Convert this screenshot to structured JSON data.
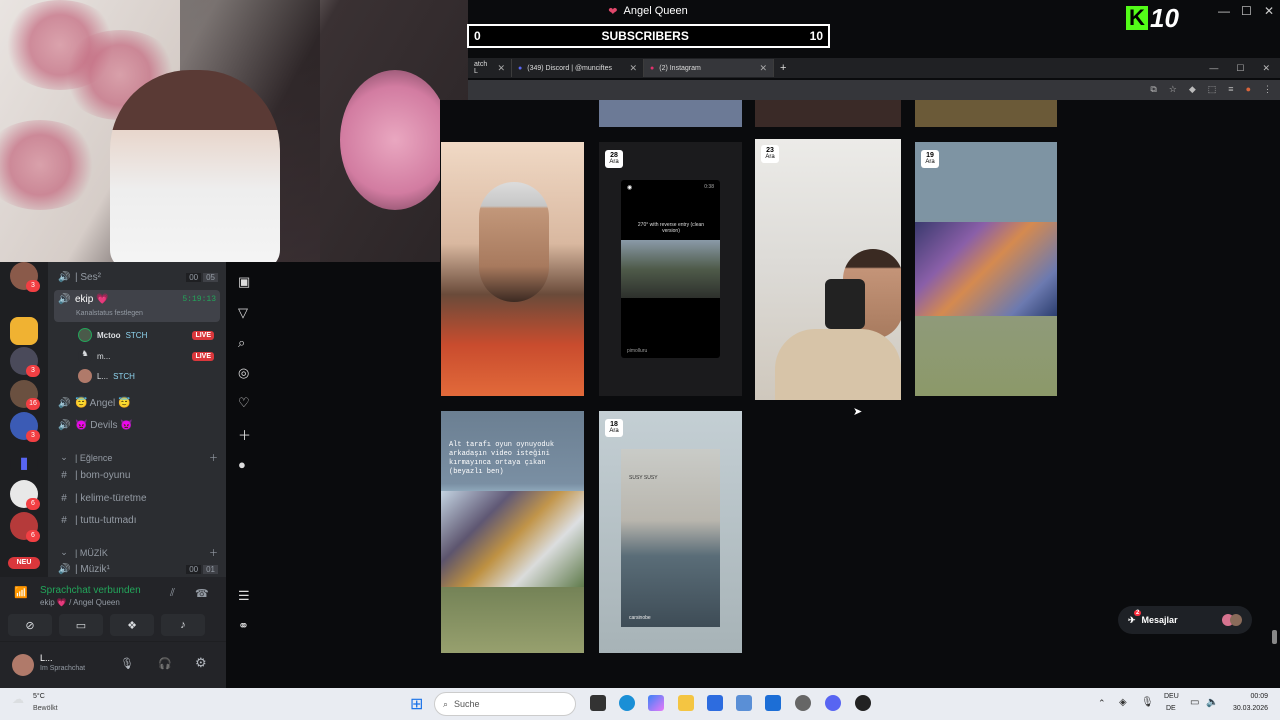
{
  "overlay": {
    "stream_title": "Angel Queen",
    "subs_current": "0",
    "subs_label": "SUBSCRIBERS",
    "subs_goal": "10",
    "logo_number": "10"
  },
  "browser": {
    "tabs": [
      {
        "label": "atch L",
        "active": false
      },
      {
        "label": "(349) Discord | @munciftes",
        "active": false
      },
      {
        "label": "(2) Instagram",
        "active": true
      }
    ],
    "new_tab": "+"
  },
  "instagram": {
    "tiles": [
      {
        "day": "28",
        "month": "Ara",
        "video_caption": "270° with reverse entry (clean version)",
        "video_footer": "pimolluru",
        "video_time": "0:38"
      },
      {
        "day": "23",
        "month": "Ara"
      },
      {
        "day": "19",
        "month": "Ara"
      },
      {
        "caption": "Alt tarafı oyun oynuyoduk arkadaşın video isteğini kırmayınca ortaya çıkan (beyazlı ben)"
      },
      {
        "day": "18",
        "month": "Ara",
        "video_top": "SUSY SUSY",
        "video_footer": "carsinobe"
      }
    ],
    "messages_label": "Mesajlar",
    "messages_badge": "2"
  },
  "discord": {
    "guild_badges": [
      "3",
      "3",
      "16",
      "3",
      "6",
      "6"
    ],
    "neu_label": "NEU",
    "channels": [
      {
        "icon": "speaker",
        "label": "| Ses²",
        "count_a": "00",
        "count_b": "05"
      },
      {
        "icon": "speaker",
        "label": "ekip 💗",
        "time": "5:19:13",
        "sub": "Kanalstatus festlegen"
      },
      {
        "label": "Mctoo",
        "tag": "STCH",
        "live": "LIVE"
      },
      {
        "label": "m...",
        "live": "LIVE"
      },
      {
        "label": "L...",
        "tag": "STCH"
      },
      {
        "icon": "speaker",
        "label": "😇 Angel 😇"
      },
      {
        "icon": "speaker",
        "label": "👿 Devils 👿"
      },
      {
        "icon": "cat",
        "label": "| Eğlence"
      },
      {
        "icon": "hash",
        "label": "| bom-oyunu"
      },
      {
        "icon": "hash",
        "label": "| kelime-türetme"
      },
      {
        "icon": "hash",
        "label": "| tuttu-tutmadı"
      },
      {
        "icon": "cat",
        "label": "| MÜZİK"
      },
      {
        "icon": "speaker",
        "label": "| Müzik¹",
        "count_a": "00",
        "count_b": "01"
      }
    ],
    "voice_status": "Sprachchat verbunden",
    "voice_channel": "ekip 💗 / Angel Queen",
    "user_name": "L...",
    "user_status": "Im Sprachchat"
  },
  "taskbar": {
    "weather_temp": "5°C",
    "weather_desc": "Bewölkt",
    "search_placeholder": "Suche",
    "lang_a": "DEU",
    "lang_b": "DE",
    "time": "00:09",
    "date": "30.03.2026"
  },
  "colors": {
    "kick_green": "#53fc18",
    "discord_bg": "#2b2d31",
    "live_red": "#da373c",
    "voice_green": "#23a55a"
  }
}
